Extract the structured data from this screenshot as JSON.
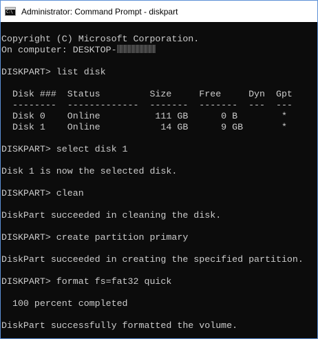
{
  "window": {
    "title": "Administrator: Command Prompt - diskpart",
    "icon_glyph": "C:\\"
  },
  "console": {
    "copyright": "Copyright (C) Microsoft Corporation.",
    "computer_label": "On computer: DESKTOP-",
    "prompt": "DISKPART> ",
    "cmd_list_disk": "list disk",
    "disk_table": {
      "header": "  Disk ###  Status         Size     Free     Dyn  Gpt",
      "separator": "  --------  -------------  -------  -------  ---  ---",
      "rows": [
        "  Disk 0    Online          111 GB      0 B        *",
        "  Disk 1    Online           14 GB      9 GB       *"
      ]
    },
    "cmd_select": "select disk 1",
    "msg_selected": "Disk 1 is now the selected disk.",
    "cmd_clean": "clean",
    "msg_clean": "DiskPart succeeded in cleaning the disk.",
    "cmd_create": "create partition primary",
    "msg_create": "DiskPart succeeded in creating the specified partition.",
    "cmd_format": "format fs=fat32 quick",
    "msg_progress": "  100 percent completed",
    "msg_format": "DiskPart successfully formatted the volume."
  },
  "colors": {
    "console_bg": "#0c0c0c",
    "console_fg": "#cccccc",
    "titlebar_bg": "#ffffff",
    "window_border": "#5b8fd6"
  }
}
